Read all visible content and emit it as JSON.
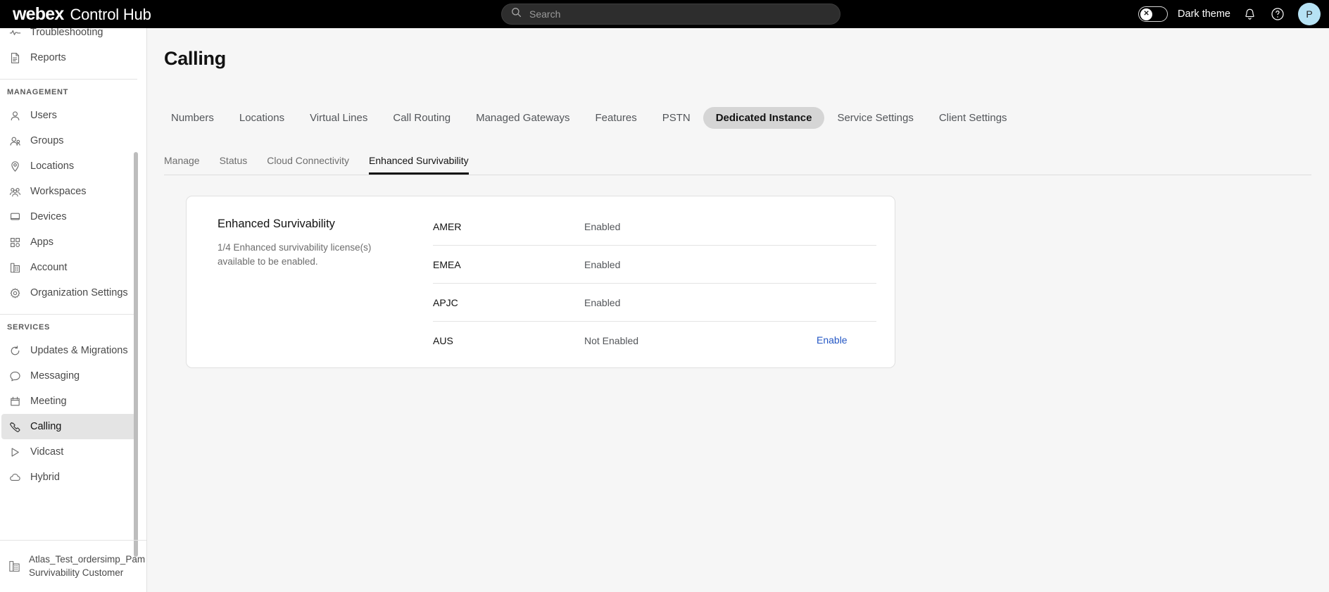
{
  "header": {
    "brand_mark": "webex",
    "brand_product": "Control Hub",
    "search": {
      "placeholder": "Search",
      "value": "",
      "icon": "search-icon"
    },
    "theme_toggle": {
      "label": "Dark theme",
      "state": "off",
      "knob_glyph": "✕"
    },
    "notifications_icon": "bell-icon",
    "help_icon": "question-circle-icon",
    "avatar_initial": "P",
    "avatar_color": "#b6e2f4",
    "background_color": "#000000"
  },
  "sidebar": {
    "top_items": [
      {
        "label": "Troubleshooting",
        "icon": "pulse-icon"
      },
      {
        "label": "Reports",
        "icon": "report-document-icon"
      }
    ],
    "sections": [
      {
        "heading": "MANAGEMENT",
        "items": [
          {
            "label": "Users",
            "icon": "user-icon"
          },
          {
            "label": "Groups",
            "icon": "groups-icon"
          },
          {
            "label": "Locations",
            "icon": "map-pin-icon"
          },
          {
            "label": "Workspaces",
            "icon": "workspaces-icon"
          },
          {
            "label": "Devices",
            "icon": "device-icon"
          },
          {
            "label": "Apps",
            "icon": "apps-grid-icon"
          },
          {
            "label": "Account",
            "icon": "account-building-icon"
          },
          {
            "label": "Organization Settings",
            "icon": "gear-icon"
          }
        ]
      },
      {
        "heading": "SERVICES",
        "items": [
          {
            "label": "Updates & Migrations",
            "icon": "refresh-icon"
          },
          {
            "label": "Messaging",
            "icon": "chat-bubble-icon"
          },
          {
            "label": "Meeting",
            "icon": "calendar-icon"
          },
          {
            "label": "Calling",
            "icon": "phone-handset-icon",
            "active": true
          },
          {
            "label": "Vidcast",
            "icon": "play-triangle-icon"
          },
          {
            "label": "Hybrid",
            "icon": "cloud-icon"
          }
        ]
      }
    ],
    "org_footer": {
      "icon": "building-icon",
      "line1": "Atlas_Test_ordersimp_Pam",
      "line2": "Survivability Customer"
    }
  },
  "main": {
    "page_title": "Calling",
    "tabs": [
      {
        "label": "Numbers"
      },
      {
        "label": "Locations"
      },
      {
        "label": "Virtual Lines"
      },
      {
        "label": "Call Routing"
      },
      {
        "label": "Managed Gateways"
      },
      {
        "label": "Features"
      },
      {
        "label": "PSTN"
      },
      {
        "label": "Dedicated Instance",
        "active": true
      },
      {
        "label": "Service Settings"
      },
      {
        "label": "Client Settings"
      }
    ],
    "subtabs": [
      {
        "label": "Manage"
      },
      {
        "label": "Status"
      },
      {
        "label": "Cloud Connectivity"
      },
      {
        "label": "Enhanced Survivability",
        "active": true
      }
    ],
    "card": {
      "title": "Enhanced Survivability",
      "description": "1/4 Enhanced survivability license(s) available to be enabled.",
      "rows": [
        {
          "region": "AMER",
          "status": "Enabled",
          "action": ""
        },
        {
          "region": "EMEA",
          "status": "Enabled",
          "action": ""
        },
        {
          "region": "APJC",
          "status": "Enabled",
          "action": ""
        },
        {
          "region": "AUS",
          "status": "Not Enabled",
          "action": "Enable"
        }
      ],
      "link_color": "#2457c5"
    }
  }
}
